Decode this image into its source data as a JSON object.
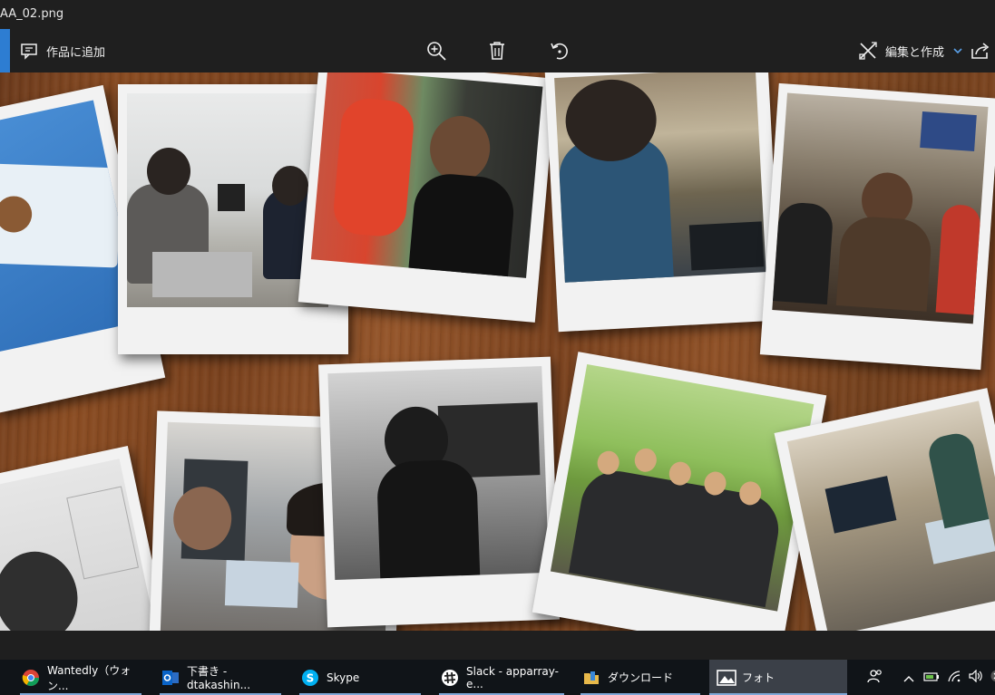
{
  "window": {
    "title": "AA_02.png"
  },
  "toolbar": {
    "add_to_creation_label": "作品に追加",
    "edit_create_label": "編集と作成"
  },
  "icons": {
    "add": "add-to-creation-icon",
    "zoom": "zoom-in-icon",
    "delete": "trash-icon",
    "rotate": "rotate-icon",
    "edit": "edit-create-icon",
    "dropdown": "chevron-down-icon",
    "share": "share-icon"
  },
  "taskbar": {
    "items": [
      {
        "label": "Wantedly（ウォン...",
        "icon": "chrome-icon"
      },
      {
        "label": "下書き - dtakashin...",
        "icon": "outlook-icon"
      },
      {
        "label": "Skype",
        "icon": "skype-icon"
      },
      {
        "label": "Slack - apparray-e...",
        "icon": "slack-icon"
      },
      {
        "label": "ダウンロード",
        "icon": "folder-icon"
      },
      {
        "label": "フォト",
        "icon": "photos-icon"
      }
    ]
  },
  "colors": {
    "accent": "#2d7dd2",
    "bar": "#1f1f1f",
    "taskbar": "#101418"
  }
}
